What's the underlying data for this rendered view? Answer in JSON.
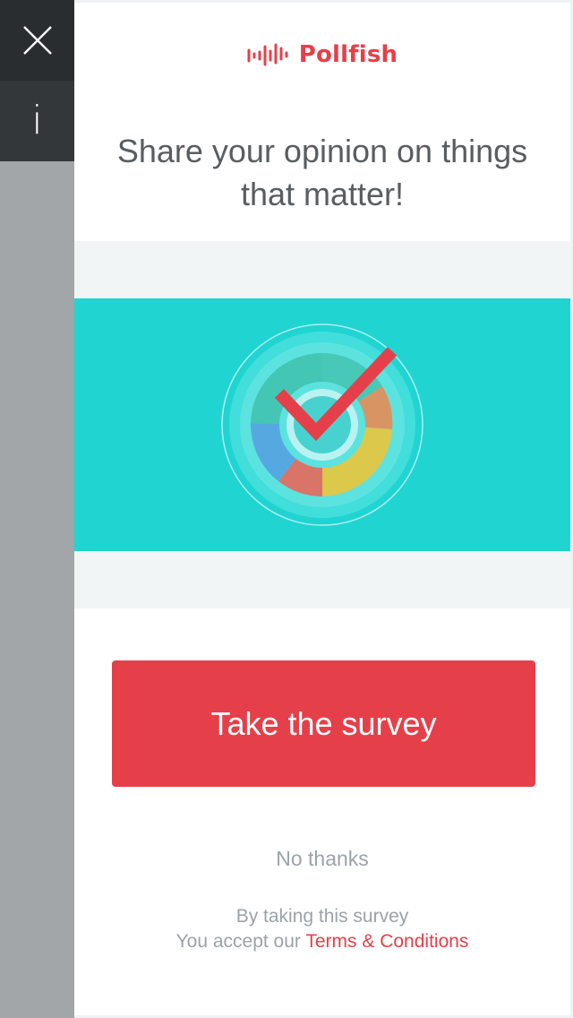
{
  "brand": {
    "name": "Pollfish",
    "logo_icon": "soundwave-icon",
    "color": "#e5404a"
  },
  "sidebar": {
    "close_icon": "close-icon",
    "info_label": "i",
    "info_icon": "info-icon"
  },
  "headline": "Share your opinion on things that matter!",
  "hero": {
    "illustration": "survey-checkmark-chart-icon",
    "background": "#20d4d2"
  },
  "cta": {
    "label": "Take the survey",
    "color": "#e5404a"
  },
  "dismiss": {
    "label": "No thanks"
  },
  "disclaimer": {
    "line1": "By taking this survey",
    "line2_prefix": "You accept our ",
    "terms_link": "Terms & Conditions"
  }
}
